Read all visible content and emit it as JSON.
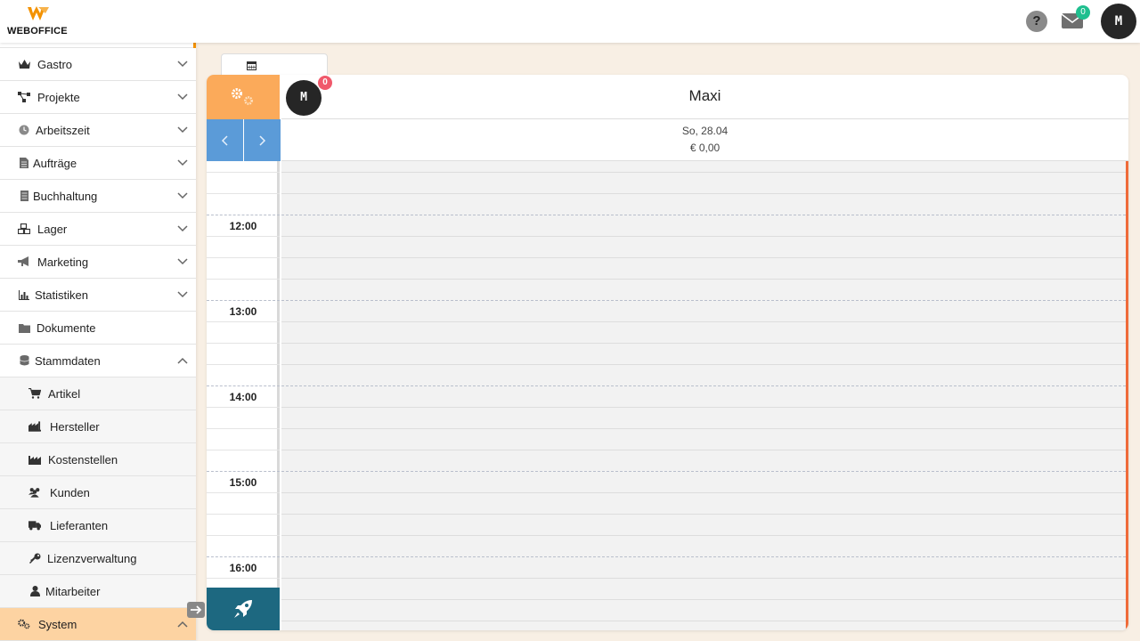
{
  "header": {
    "logo_text": "WEBOFFICE",
    "help_label": "?",
    "mail_count": "0",
    "user_initial": "M",
    "brand_color": "#f39200"
  },
  "sidebar": {
    "items": [
      {
        "label": "Gastro",
        "icon": "crown-icon",
        "expandable": true
      },
      {
        "label": "Projekte",
        "icon": "network-icon",
        "expandable": true
      },
      {
        "label": "Arbeitszeit",
        "icon": "clock-icon",
        "expandable": true
      },
      {
        "label": "Aufträge",
        "icon": "document-icon",
        "expandable": true
      },
      {
        "label": "Buchhaltung",
        "icon": "ledger-icon",
        "expandable": true
      },
      {
        "label": "Lager",
        "icon": "boxes-icon",
        "expandable": true
      },
      {
        "label": "Marketing",
        "icon": "megaphone-icon",
        "expandable": true
      },
      {
        "label": "Statistiken",
        "icon": "bar-chart-icon",
        "expandable": true
      },
      {
        "label": "Dokumente",
        "icon": "folder-icon",
        "expandable": false
      },
      {
        "label": "Stammdaten",
        "icon": "database-icon",
        "expandable": true,
        "expanded": true
      }
    ],
    "sub_items": [
      {
        "label": "Artikel",
        "icon": "cart-icon"
      },
      {
        "label": "Hersteller",
        "icon": "factory-icon"
      },
      {
        "label": "Kostenstellen",
        "icon": "industry-icon"
      },
      {
        "label": "Kunden",
        "icon": "users-icon"
      },
      {
        "label": "Lieferanten",
        "icon": "truck-icon"
      },
      {
        "label": "Lizenzverwaltung",
        "icon": "key-icon"
      },
      {
        "label": "Mitarbeiter",
        "icon": "user-icon"
      }
    ],
    "active_item": {
      "label": "System",
      "icon": "cogs-icon",
      "expanded": true
    }
  },
  "calendar": {
    "resource": {
      "name": "Maxi",
      "initial": "M",
      "badge": "0"
    },
    "day": {
      "date": "So, 28.04",
      "sum": "€ 0,00"
    },
    "hours": [
      "12:00",
      "13:00",
      "14:00",
      "15:00",
      "16:00"
    ],
    "colors": {
      "settings": "#fbaa5a",
      "nav": "#5b9bd8",
      "rocket": "#1d6880",
      "now_line": "#ef6b3a"
    }
  }
}
